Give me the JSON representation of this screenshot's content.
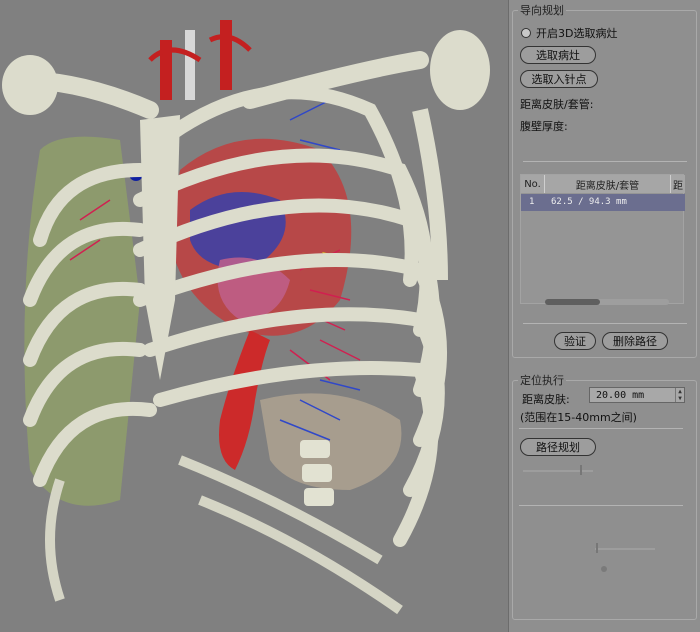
{
  "panel": {
    "navigation": {
      "title": "导向规划",
      "enable_3d_label": "开启3D选取病灶",
      "select_lesion_label": "选取病灶",
      "select_entry_label": "选取入针点",
      "skin_distance_label": "距离皮肤/套管:",
      "fat_thickness_label": "腹壁厚度:",
      "disabled_row": "",
      "table": {
        "headers": [
          "No.",
          "距离皮肤/套管",
          "距"
        ],
        "rows": [
          {
            "no": "1",
            "value": "62.5 / 94.3 mm"
          }
        ]
      },
      "verify_label": "验证",
      "delete_label": "删除路径"
    },
    "positioning": {
      "title": "定位执行",
      "distance_label": "距离皮肤:",
      "distance_value": "20.00  mm",
      "range_hint": "(范围在15-40mm之间)",
      "plan_label": "路径规划"
    }
  },
  "colors": {
    "background": "#808080",
    "panel": "#8f8f8f",
    "bone": "#dcdccc",
    "artery": "#c42020",
    "vein": "#3040c0",
    "selected_row": "#6b6e8f"
  }
}
